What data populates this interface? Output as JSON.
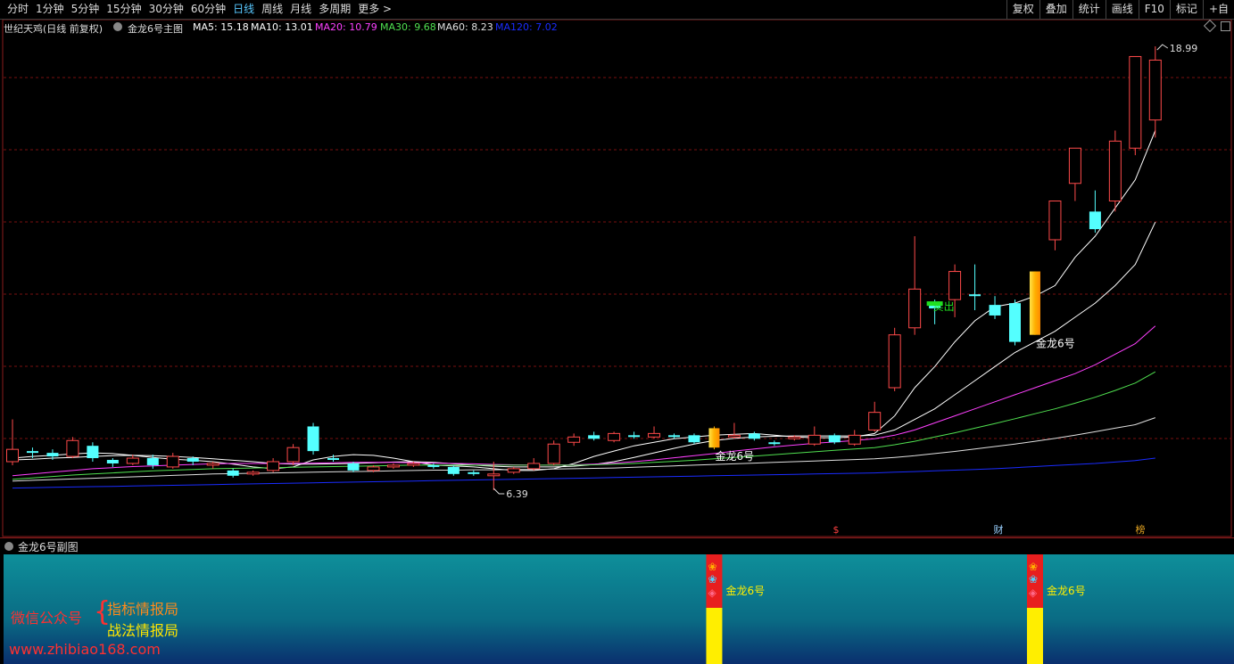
{
  "toolbar": {
    "periods": [
      "分时",
      "1分钟",
      "5分钟",
      "15分钟",
      "30分钟",
      "60分钟",
      "日线",
      "周线",
      "月线",
      "多周期",
      "更多 >"
    ],
    "active_period": "日线",
    "right_buttons": [
      "复权",
      "叠加",
      "统计",
      "画线",
      "F10",
      "标记",
      "+自"
    ]
  },
  "infobar": {
    "stock_title": "世纪天鸡(日线 前复权)",
    "indicator_name": "金龙6号主图",
    "ma5": "MA5: 15.18",
    "ma10": "MA10: 13.01",
    "ma20": "MA20: 10.79",
    "ma30": "MA30: 9.68",
    "ma60": "MA60: 8.23",
    "ma120": "MA120: 7.02"
  },
  "colors": {
    "up": "#ff4a4a",
    "down": "#54ffff",
    "ma5": "#ffffff",
    "ma10": "#ffffff",
    "ma20": "#ff40ff",
    "ma30": "#50e050",
    "ma60": "#e0e0e0",
    "ma120": "#1a2cff",
    "grid": "#7a1010",
    "signal": "#ffc400"
  },
  "chart_data": {
    "type": "candlestick",
    "price_high_label": "18.99",
    "price_low_label": "6.39",
    "sell_label": "卖出",
    "signal_label": "金龙6号",
    "event_markers": [
      "$",
      "财",
      "榜"
    ],
    "candles": [
      {
        "o": 7.2,
        "c": 7.55,
        "h": 8.4,
        "l": 7.1
      },
      {
        "o": 7.5,
        "c": 7.45,
        "h": 7.6,
        "l": 7.3
      },
      {
        "o": 7.45,
        "c": 7.35,
        "h": 7.55,
        "l": 7.25
      },
      {
        "o": 7.35,
        "c": 7.8,
        "h": 7.9,
        "l": 7.3
      },
      {
        "o": 7.65,
        "c": 7.3,
        "h": 7.75,
        "l": 7.2
      },
      {
        "o": 7.25,
        "c": 7.15,
        "h": 7.3,
        "l": 7.05
      },
      {
        "o": 7.15,
        "c": 7.3,
        "h": 7.4,
        "l": 7.1
      },
      {
        "o": 7.3,
        "c": 7.1,
        "h": 7.4,
        "l": 7.0
      },
      {
        "o": 7.05,
        "c": 7.35,
        "h": 7.45,
        "l": 7.0
      },
      {
        "o": 7.3,
        "c": 7.2,
        "h": 7.35,
        "l": 7.1
      },
      {
        "o": 7.1,
        "c": 7.15,
        "h": 7.2,
        "l": 7.0
      },
      {
        "o": 6.95,
        "c": 6.8,
        "h": 7.0,
        "l": 6.75
      },
      {
        "o": 6.85,
        "c": 6.9,
        "h": 6.95,
        "l": 6.8
      },
      {
        "o": 6.95,
        "c": 7.2,
        "h": 7.3,
        "l": 6.9
      },
      {
        "o": 7.2,
        "c": 7.6,
        "h": 7.7,
        "l": 7.1
      },
      {
        "o": 8.2,
        "c": 7.5,
        "h": 8.3,
        "l": 7.4
      },
      {
        "o": 7.3,
        "c": 7.25,
        "h": 7.4,
        "l": 7.2
      },
      {
        "o": 7.15,
        "c": 6.95,
        "h": 7.2,
        "l": 6.9
      },
      {
        "o": 6.95,
        "c": 7.05,
        "h": 7.1,
        "l": 6.9
      },
      {
        "o": 7.05,
        "c": 7.1,
        "h": 7.15,
        "l": 7.0
      },
      {
        "o": 7.1,
        "c": 7.15,
        "h": 7.2,
        "l": 7.05
      },
      {
        "o": 7.1,
        "c": 7.05,
        "h": 7.15,
        "l": 7.0
      },
      {
        "o": 7.05,
        "c": 6.85,
        "h": 7.1,
        "l": 6.8
      },
      {
        "o": 6.9,
        "c": 6.85,
        "h": 6.95,
        "l": 6.8
      },
      {
        "o": 6.8,
        "c": 6.85,
        "h": 7.2,
        "l": 6.39
      },
      {
        "o": 6.9,
        "c": 7.0,
        "h": 7.05,
        "l": 6.85
      },
      {
        "o": 7.0,
        "c": 7.15,
        "h": 7.3,
        "l": 6.95
      },
      {
        "o": 7.15,
        "c": 7.7,
        "h": 7.8,
        "l": 7.1
      },
      {
        "o": 7.75,
        "c": 7.9,
        "h": 8.0,
        "l": 7.65
      },
      {
        "o": 7.95,
        "c": 7.85,
        "h": 8.05,
        "l": 7.8
      },
      {
        "o": 7.8,
        "c": 8.0,
        "h": 8.05,
        "l": 7.75
      },
      {
        "o": 7.95,
        "c": 7.9,
        "h": 8.05,
        "l": 7.85
      },
      {
        "o": 7.9,
        "c": 8.0,
        "h": 8.2,
        "l": 7.85
      },
      {
        "o": 7.95,
        "c": 7.9,
        "h": 8.0,
        "l": 7.85
      },
      {
        "o": 7.95,
        "c": 7.75,
        "h": 8.0,
        "l": 7.7
      },
      {
        "o": 7.6,
        "c": 8.15,
        "h": 8.2,
        "l": 7.55,
        "signal": true
      },
      {
        "o": 7.9,
        "c": 7.95,
        "h": 8.3,
        "l": 7.85
      },
      {
        "o": 8.0,
        "c": 7.85,
        "h": 8.05,
        "l": 7.8
      },
      {
        "o": 7.75,
        "c": 7.7,
        "h": 7.8,
        "l": 7.65
      },
      {
        "o": 7.85,
        "c": 7.9,
        "h": 7.95,
        "l": 7.8
      },
      {
        "o": 7.7,
        "c": 7.95,
        "h": 8.2,
        "l": 7.65
      },
      {
        "o": 7.95,
        "c": 7.75,
        "h": 8.0,
        "l": 7.7
      },
      {
        "o": 7.7,
        "c": 7.95,
        "h": 8.1,
        "l": 7.65
      },
      {
        "o": 8.1,
        "c": 8.6,
        "h": 8.9,
        "l": 8.05
      },
      {
        "o": 9.3,
        "c": 10.8,
        "h": 11.0,
        "l": 9.2
      },
      {
        "o": 11.0,
        "c": 12.1,
        "h": 13.6,
        "l": 10.8
      },
      {
        "o": 11.7,
        "c": 11.55,
        "h": 11.8,
        "l": 11.1,
        "sell": true
      },
      {
        "o": 11.8,
        "c": 12.6,
        "h": 12.8,
        "l": 11.3
      },
      {
        "o": 11.95,
        "c": 11.9,
        "h": 12.8,
        "l": 11.5
      },
      {
        "o": 11.65,
        "c": 11.35,
        "h": 11.9,
        "l": 11.25
      },
      {
        "o": 11.7,
        "c": 10.6,
        "h": 11.8,
        "l": 10.5
      },
      {
        "o": 10.8,
        "c": 12.6,
        "h": 12.6,
        "l": 10.8,
        "signal": true
      },
      {
        "o": 13.5,
        "c": 14.6,
        "h": 14.6,
        "l": 13.2
      },
      {
        "o": 15.1,
        "c": 16.1,
        "h": 16.1,
        "l": 14.6
      },
      {
        "o": 14.3,
        "c": 13.8,
        "h": 14.9,
        "l": 13.7
      },
      {
        "o": 14.6,
        "c": 16.3,
        "h": 16.6,
        "l": 14.3
      },
      {
        "o": 16.1,
        "c": 18.7,
        "h": 18.7,
        "l": 15.9
      },
      {
        "o": 16.9,
        "c": 18.6,
        "h": 18.99,
        "l": 16.4
      }
    ],
    "ma_series": [
      {
        "name": "MA5",
        "values": [
          7.3,
          7.35,
          7.38,
          7.42,
          7.45,
          7.43,
          7.38,
          7.32,
          7.27,
          7.24,
          7.2,
          7.13,
          7.05,
          7.0,
          7.05,
          7.25,
          7.35,
          7.4,
          7.38,
          7.3,
          7.2,
          7.1,
          7.08,
          7.05,
          7.0,
          6.95,
          6.95,
          7.0,
          7.15,
          7.35,
          7.5,
          7.65,
          7.75,
          7.85,
          7.9,
          7.95,
          7.98,
          8.0,
          7.95,
          7.9,
          7.88,
          7.88,
          7.9,
          8.0,
          8.5,
          9.3,
          9.9,
          10.6,
          11.2,
          11.6,
          11.7,
          11.9,
          12.2,
          13.0,
          13.6,
          14.4,
          15.2,
          16.6
        ]
      },
      {
        "name": "MA10",
        "values": [
          7.25,
          7.27,
          7.3,
          7.32,
          7.35,
          7.37,
          7.38,
          7.37,
          7.35,
          7.32,
          7.28,
          7.24,
          7.2,
          7.15,
          7.13,
          7.13,
          7.14,
          7.15,
          7.17,
          7.19,
          7.2,
          7.18,
          7.14,
          7.1,
          7.07,
          7.05,
          7.05,
          7.05,
          7.07,
          7.12,
          7.2,
          7.32,
          7.45,
          7.58,
          7.7,
          7.8,
          7.86,
          7.9,
          7.92,
          7.93,
          7.93,
          7.93,
          7.93,
          7.95,
          8.1,
          8.4,
          8.7,
          9.1,
          9.5,
          9.9,
          10.3,
          10.6,
          10.9,
          11.3,
          11.7,
          12.2,
          12.8,
          14.0
        ]
      },
      {
        "name": "MA20",
        "values": [
          6.8,
          6.85,
          6.9,
          6.95,
          7.0,
          7.03,
          7.06,
          7.08,
          7.1,
          7.12,
          7.14,
          7.15,
          7.15,
          7.15,
          7.15,
          7.16,
          7.17,
          7.18,
          7.18,
          7.18,
          7.17,
          7.16,
          7.15,
          7.14,
          7.12,
          7.11,
          7.1,
          7.1,
          7.11,
          7.13,
          7.16,
          7.2,
          7.25,
          7.31,
          7.37,
          7.43,
          7.5,
          7.56,
          7.62,
          7.67,
          7.72,
          7.76,
          7.8,
          7.85,
          7.95,
          8.1,
          8.3,
          8.5,
          8.7,
          8.9,
          9.1,
          9.3,
          9.5,
          9.7,
          9.95,
          10.25,
          10.55,
          11.05
        ]
      },
      {
        "name": "MA30",
        "values": [
          6.7,
          6.74,
          6.78,
          6.82,
          6.85,
          6.88,
          6.91,
          6.94,
          6.96,
          6.98,
          7.0,
          7.01,
          7.02,
          7.03,
          7.04,
          7.05,
          7.06,
          7.07,
          7.08,
          7.09,
          7.1,
          7.1,
          7.1,
          7.1,
          7.1,
          7.1,
          7.1,
          7.1,
          7.1,
          7.11,
          7.13,
          7.15,
          7.18,
          7.21,
          7.24,
          7.28,
          7.32,
          7.36,
          7.4,
          7.44,
          7.48,
          7.52,
          7.56,
          7.6,
          7.68,
          7.78,
          7.9,
          8.02,
          8.15,
          8.28,
          8.42,
          8.56,
          8.7,
          8.86,
          9.03,
          9.22,
          9.43,
          9.75
        ]
      },
      {
        "name": "MA60",
        "values": [
          6.65,
          6.67,
          6.69,
          6.71,
          6.73,
          6.75,
          6.77,
          6.79,
          6.81,
          6.83,
          6.85,
          6.86,
          6.87,
          6.88,
          6.89,
          6.9,
          6.91,
          6.92,
          6.93,
          6.94,
          6.95,
          6.96,
          6.96,
          6.97,
          6.97,
          6.98,
          6.98,
          6.99,
          7.0,
          7.01,
          7.02,
          7.04,
          7.06,
          7.08,
          7.1,
          7.12,
          7.14,
          7.16,
          7.18,
          7.2,
          7.22,
          7.24,
          7.26,
          7.28,
          7.32,
          7.37,
          7.43,
          7.49,
          7.56,
          7.63,
          7.7,
          7.78,
          7.86,
          7.95,
          8.05,
          8.15,
          8.25,
          8.45
        ]
      },
      {
        "name": "MA120",
        "values": [
          6.45,
          6.46,
          6.47,
          6.48,
          6.49,
          6.5,
          6.51,
          6.52,
          6.53,
          6.54,
          6.55,
          6.56,
          6.57,
          6.58,
          6.59,
          6.6,
          6.61,
          6.62,
          6.63,
          6.64,
          6.65,
          6.66,
          6.67,
          6.68,
          6.69,
          6.7,
          6.71,
          6.72,
          6.73,
          6.74,
          6.75,
          6.76,
          6.77,
          6.78,
          6.79,
          6.8,
          6.81,
          6.82,
          6.83,
          6.84,
          6.85,
          6.86,
          6.87,
          6.88,
          6.9,
          6.92,
          6.94,
          6.96,
          6.98,
          7.0,
          7.03,
          7.06,
          7.09,
          7.12,
          7.15,
          7.19,
          7.23,
          7.3
        ]
      }
    ]
  },
  "subchart": {
    "title": "金龙6号副图",
    "signal_label": "金龙6号",
    "signal_indices": [
      35,
      51
    ]
  },
  "watermark": {
    "label": "微信公众号",
    "line1": "指标情报局",
    "line2": "战法情报局",
    "url": "www.zhibiao168.com"
  }
}
